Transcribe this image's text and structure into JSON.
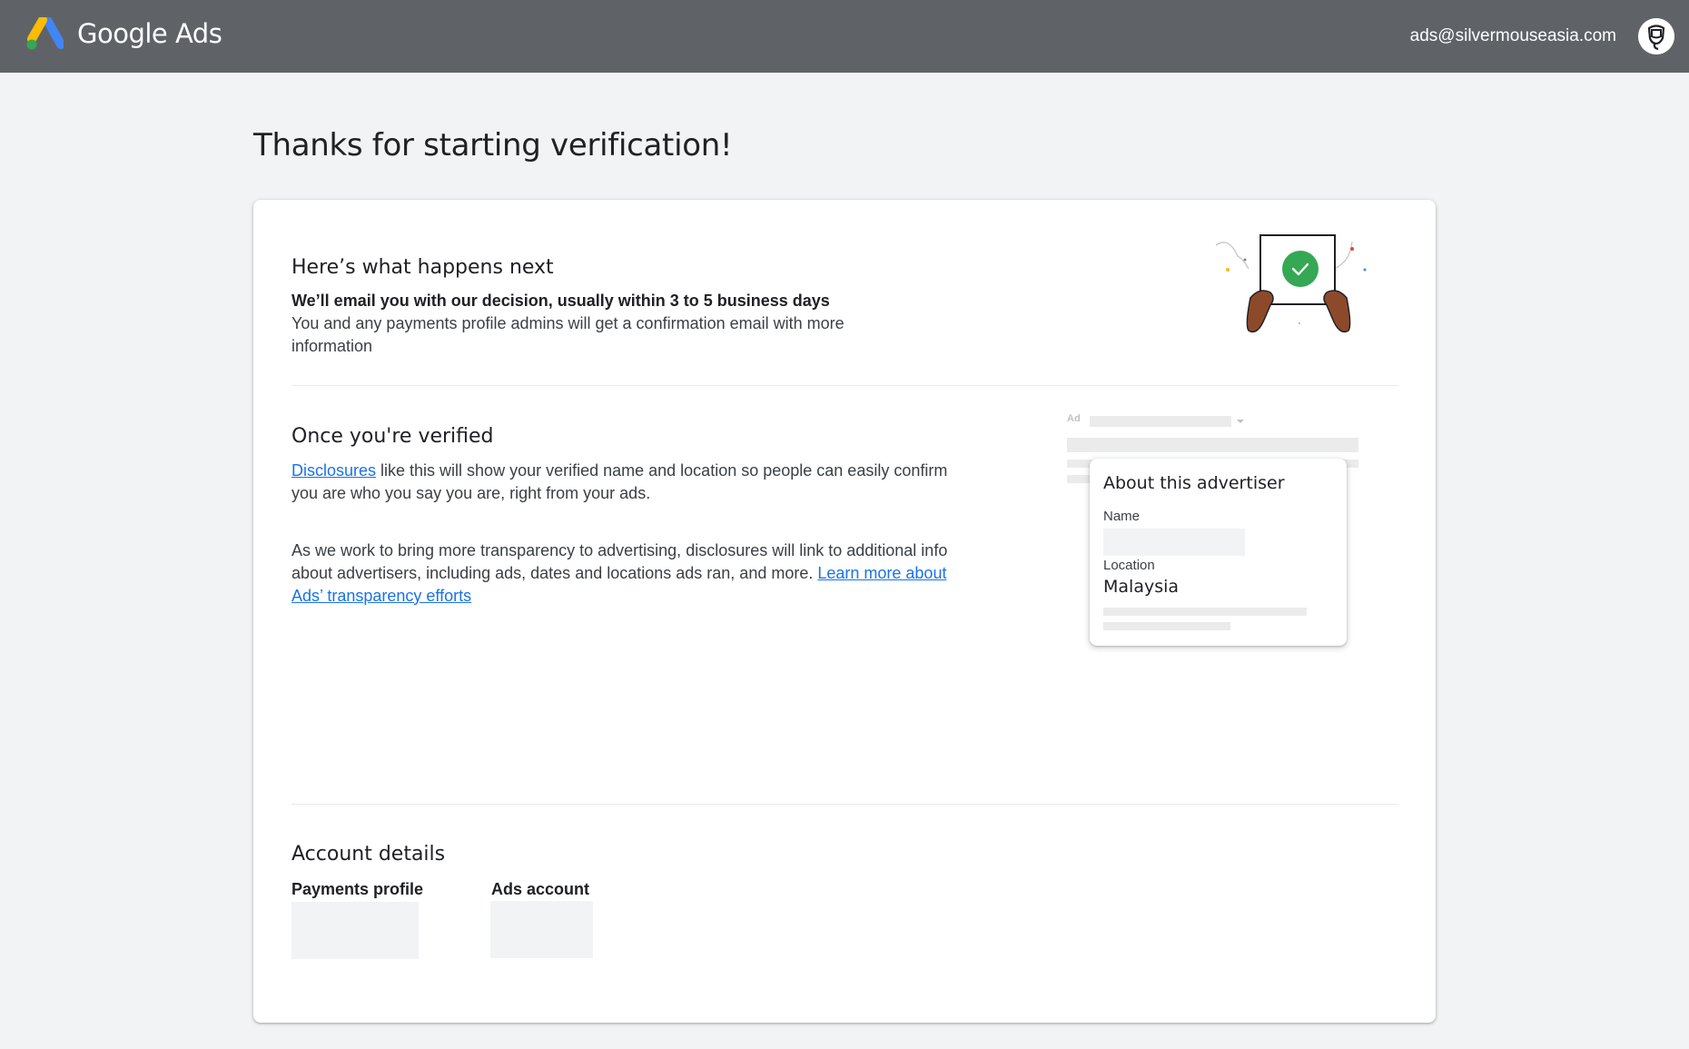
{
  "header": {
    "app_name": "Google Ads",
    "user_email": "ads@silvermouseasia.com"
  },
  "page": {
    "title": "Thanks for starting verification!"
  },
  "next": {
    "title": "Here’s what happens next",
    "emphasis": "We’ll email you with our decision, usually within 3 to 5 business days",
    "detail": "You and any payments profile admins will get a confirmation email with more information"
  },
  "verified": {
    "title": "Once you're verified",
    "disclosures_link": "Disclosures",
    "para1_rest": " like this will show your verified name and location so people can easily confirm you are who you say you are, right from your ads.",
    "para2_text": "As we work to bring more transparency to advertising, disclosures will link to additional info about advertisers, including ads, dates and locations ads ran, and more. ",
    "learn_more_link": "Learn more about Ads’ transparency efforts"
  },
  "disclosure_mock": {
    "ad_label": "Ad",
    "card_title": "About this advertiser",
    "name_label": "Name",
    "location_label": "Location",
    "location_value": "Malaysia"
  },
  "account_details": {
    "title": "Account details",
    "payments_profile_label": "Payments profile",
    "ads_account_label": "Ads account"
  },
  "colors": {
    "header_bg": "#5f6368",
    "page_bg": "#f1f3f4",
    "link": "#1a73e8",
    "check_green": "#34a853"
  }
}
